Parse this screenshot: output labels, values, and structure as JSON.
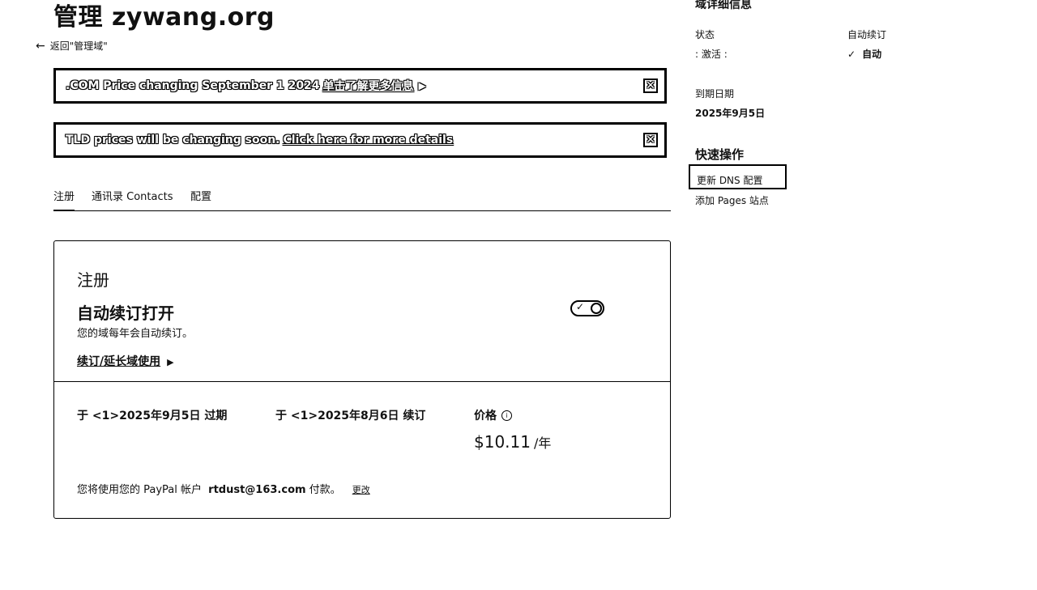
{
  "header": {
    "title": "管理 zywang.org",
    "back_label": "返回\"管理域\""
  },
  "banners": [
    {
      "text": ".COM Price changing September 1 2024",
      "link": "单击了解更多信息",
      "close": "✕"
    },
    {
      "text": "TLD prices will be changing soon.",
      "link": "Click here for more details",
      "close": "✕"
    }
  ],
  "tabs": [
    "注册",
    "通讯录 Contacts",
    "配置"
  ],
  "registration": {
    "title": "注册",
    "auto_renew_title": "自动续订打开",
    "auto_renew_desc": "您的域每年会自动续订。",
    "toggle_on": true,
    "renew_link": "续订/延长域使用",
    "expire_label": "于 <1>2025年9月5日 过期",
    "renew_label": "于 <1>2025年8月6日 续订",
    "price_label": "价格",
    "price_value": "$10.11",
    "price_unit": "/年",
    "payment_prefix": "您将使用您的 PayPal 帐户",
    "payment_email": "rtdust@163.com",
    "payment_suffix": "付款。",
    "change_link": "更改"
  },
  "details": {
    "title": "域详细信息",
    "status_label": "状态",
    "status_value": "激活",
    "auto_renew_label": "自动续订",
    "auto_renew_value": "自动",
    "expiry_label": "到期日期",
    "expiry_value": "2025年9月5日"
  },
  "quick_actions": {
    "title": "快速操作",
    "items": [
      "更新 DNS 配置",
      "添加 Pages 站点"
    ]
  }
}
